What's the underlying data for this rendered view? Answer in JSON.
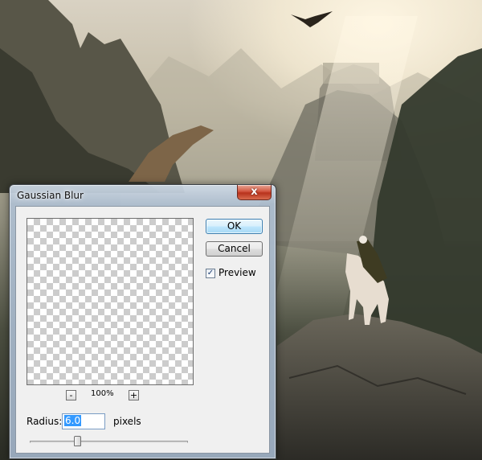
{
  "dialog": {
    "title": "Gaussian Blur",
    "close_glyph": "x",
    "ok_label": "OK",
    "cancel_label": "Cancel",
    "preview_label": "Preview",
    "preview_checked": true,
    "check_glyph": "✓",
    "zoom_out_glyph": "-",
    "zoom_in_glyph": "+",
    "zoom_level": "100%",
    "radius_label": "Radius:",
    "radius_value": "6.0",
    "units_label": "pixels",
    "slider_fraction": 0.29
  },
  "icons": {
    "close": "close-icon",
    "zoom_out": "minus-icon",
    "zoom_in": "plus-icon",
    "check": "check-icon"
  },
  "colors": {
    "default_button_border": "#3c7fb1",
    "selection_highlight": "#3399ff",
    "close_button": "#c84a32"
  }
}
